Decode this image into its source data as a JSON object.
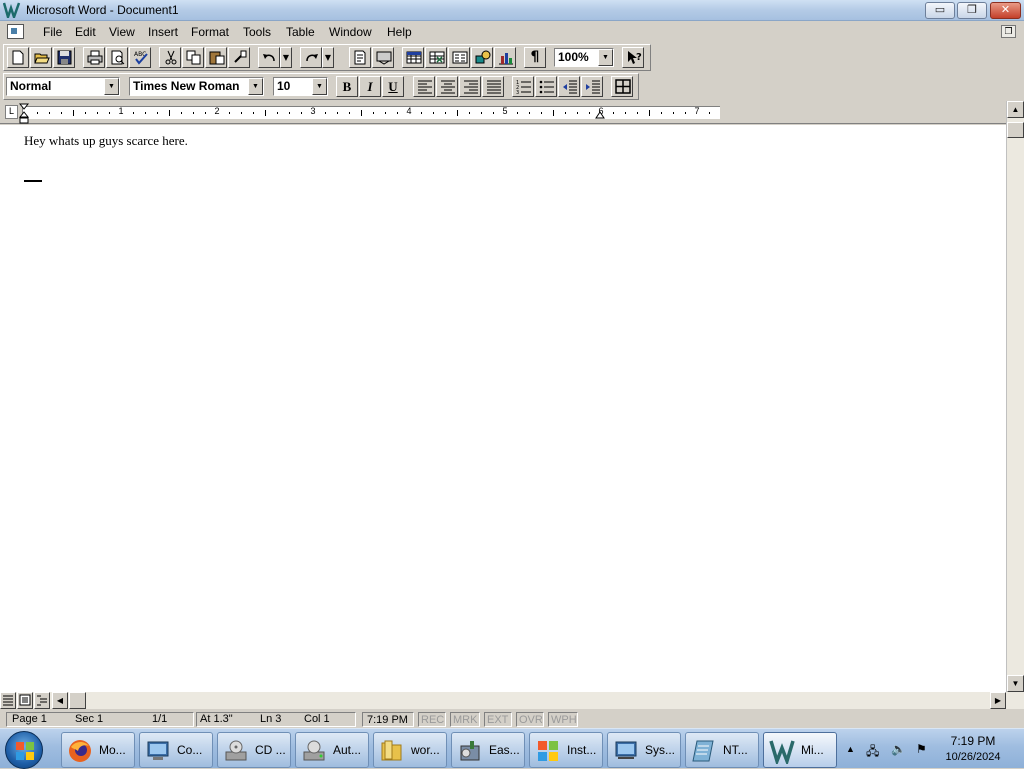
{
  "window": {
    "title": "Microsoft Word - Document1",
    "buttons": {
      "minimize": "▭",
      "restore": "❐",
      "close": "✕"
    }
  },
  "menu": {
    "items": [
      "File",
      "Edit",
      "View",
      "Insert",
      "Format",
      "Tools",
      "Table",
      "Window",
      "Help"
    ],
    "doc_restore": "❐"
  },
  "toolbar": {
    "zoom_value": "100%",
    "pilcrow": "¶",
    "dropdown_arrow": "▼"
  },
  "format_toolbar": {
    "style_value": "Normal",
    "font_value": "Times New Roman",
    "size_value": "10",
    "bold": "B",
    "italic": "I",
    "underline": "U"
  },
  "ruler": {
    "numbers": [
      "1",
      "2",
      "3",
      "4",
      "5",
      "6",
      "7"
    ],
    "tab_selector": "L"
  },
  "document": {
    "text": "Hey whats up guys scarce here."
  },
  "scroll": {
    "up": "▲",
    "down": "▼",
    "left": "◀",
    "right": "▶"
  },
  "statusbar": {
    "page": "Page 1",
    "sec": "Sec 1",
    "pages": "1/1",
    "at": "At 1.3\"",
    "ln": "Ln 3",
    "col": "Col 1",
    "time": "7:19 PM",
    "rec": "REC",
    "mrk": "MRK",
    "ext": "EXT",
    "ovr": "OVR",
    "wph": "WPH"
  },
  "taskbar": {
    "buttons": [
      {
        "label": "Mo...",
        "icon": "firefox-icon",
        "color": "#e8621e"
      },
      {
        "label": "Co...",
        "icon": "computer-icon",
        "color": "#3b6ea8"
      },
      {
        "label": "CD ...",
        "icon": "cd-drive-icon",
        "color": "#a0a0a0"
      },
      {
        "label": "Aut...",
        "icon": "drive-icon",
        "color": "#a0a0a0"
      },
      {
        "label": "wor...",
        "icon": "folder-icon",
        "color": "#e8c14a"
      },
      {
        "label": "Eas...",
        "icon": "installer-icon",
        "color": "#7a8da6"
      },
      {
        "label": "Inst...",
        "icon": "windows-flag-icon",
        "color": "#2f7bd1"
      },
      {
        "label": "Sys...",
        "icon": "system-icon",
        "color": "#3b6ea8"
      },
      {
        "label": "NT...",
        "icon": "notebook-icon",
        "color": "#7fb2d6"
      },
      {
        "label": "Mi...",
        "icon": "word-icon",
        "color": "#2a6a6a"
      }
    ],
    "tray": {
      "show_hidden": "▲",
      "network": "🖧",
      "volume": "🔈",
      "flag": "⚑"
    },
    "clock_time": "7:19 PM",
    "clock_date": "10/26/2024"
  }
}
